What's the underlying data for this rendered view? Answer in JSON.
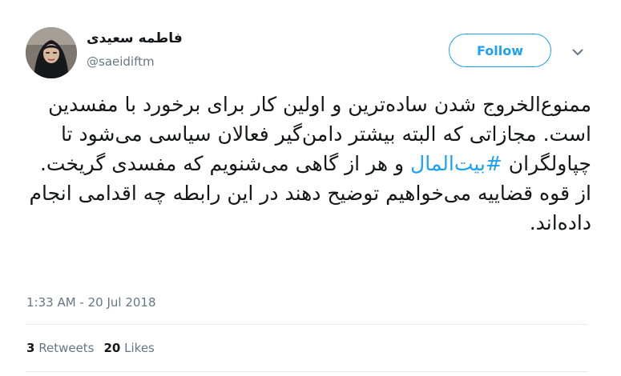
{
  "author": {
    "display_name": "فاطمه سعیدی",
    "handle": "@saeidiftm"
  },
  "actions": {
    "follow_label": "Follow"
  },
  "tweet": {
    "text_before": "ممنوع‌الخروج شدن ساده‌ترین و اولین کار برای برخورد با مفسدین است. مجازاتی که البته بیشتر دامن‌گیر فعالان سیاسی می‌شود تا چپاولگران ",
    "hashtag": "#بیت‌المال",
    "text_after": " و هر از گاهی می‌شنویم که مفسدی گریخت. از قوه قضاییه می‌خواهیم توضیح دهند در این رابطه چه اقدامی انجام داده‌اند.",
    "timestamp": "1:33 AM - 20 Jul 2018"
  },
  "stats": {
    "retweets_count": "3",
    "retweets_label": "Retweets",
    "likes_count": "20",
    "likes_label": "Likes"
  },
  "colors": {
    "accent": "#1da1f2",
    "secondary_text": "#657786",
    "divider": "#e6ecf0"
  }
}
